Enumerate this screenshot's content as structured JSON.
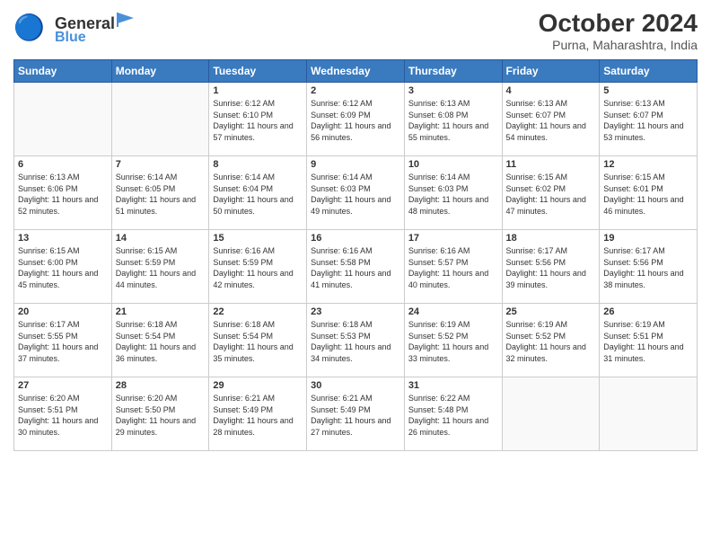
{
  "header": {
    "logo_general": "General",
    "logo_blue": "Blue",
    "title": "October 2024",
    "subtitle": "Purna, Maharashtra, India"
  },
  "calendar": {
    "headers": [
      "Sunday",
      "Monday",
      "Tuesday",
      "Wednesday",
      "Thursday",
      "Friday",
      "Saturday"
    ],
    "weeks": [
      [
        {
          "day": "",
          "info": ""
        },
        {
          "day": "",
          "info": ""
        },
        {
          "day": "1",
          "info": "Sunrise: 6:12 AM\nSunset: 6:10 PM\nDaylight: 11 hours and 57 minutes."
        },
        {
          "day": "2",
          "info": "Sunrise: 6:12 AM\nSunset: 6:09 PM\nDaylight: 11 hours and 56 minutes."
        },
        {
          "day": "3",
          "info": "Sunrise: 6:13 AM\nSunset: 6:08 PM\nDaylight: 11 hours and 55 minutes."
        },
        {
          "day": "4",
          "info": "Sunrise: 6:13 AM\nSunset: 6:07 PM\nDaylight: 11 hours and 54 minutes."
        },
        {
          "day": "5",
          "info": "Sunrise: 6:13 AM\nSunset: 6:07 PM\nDaylight: 11 hours and 53 minutes."
        }
      ],
      [
        {
          "day": "6",
          "info": "Sunrise: 6:13 AM\nSunset: 6:06 PM\nDaylight: 11 hours and 52 minutes."
        },
        {
          "day": "7",
          "info": "Sunrise: 6:14 AM\nSunset: 6:05 PM\nDaylight: 11 hours and 51 minutes."
        },
        {
          "day": "8",
          "info": "Sunrise: 6:14 AM\nSunset: 6:04 PM\nDaylight: 11 hours and 50 minutes."
        },
        {
          "day": "9",
          "info": "Sunrise: 6:14 AM\nSunset: 6:03 PM\nDaylight: 11 hours and 49 minutes."
        },
        {
          "day": "10",
          "info": "Sunrise: 6:14 AM\nSunset: 6:03 PM\nDaylight: 11 hours and 48 minutes."
        },
        {
          "day": "11",
          "info": "Sunrise: 6:15 AM\nSunset: 6:02 PM\nDaylight: 11 hours and 47 minutes."
        },
        {
          "day": "12",
          "info": "Sunrise: 6:15 AM\nSunset: 6:01 PM\nDaylight: 11 hours and 46 minutes."
        }
      ],
      [
        {
          "day": "13",
          "info": "Sunrise: 6:15 AM\nSunset: 6:00 PM\nDaylight: 11 hours and 45 minutes."
        },
        {
          "day": "14",
          "info": "Sunrise: 6:15 AM\nSunset: 5:59 PM\nDaylight: 11 hours and 44 minutes."
        },
        {
          "day": "15",
          "info": "Sunrise: 6:16 AM\nSunset: 5:59 PM\nDaylight: 11 hours and 42 minutes."
        },
        {
          "day": "16",
          "info": "Sunrise: 6:16 AM\nSunset: 5:58 PM\nDaylight: 11 hours and 41 minutes."
        },
        {
          "day": "17",
          "info": "Sunrise: 6:16 AM\nSunset: 5:57 PM\nDaylight: 11 hours and 40 minutes."
        },
        {
          "day": "18",
          "info": "Sunrise: 6:17 AM\nSunset: 5:56 PM\nDaylight: 11 hours and 39 minutes."
        },
        {
          "day": "19",
          "info": "Sunrise: 6:17 AM\nSunset: 5:56 PM\nDaylight: 11 hours and 38 minutes."
        }
      ],
      [
        {
          "day": "20",
          "info": "Sunrise: 6:17 AM\nSunset: 5:55 PM\nDaylight: 11 hours and 37 minutes."
        },
        {
          "day": "21",
          "info": "Sunrise: 6:18 AM\nSunset: 5:54 PM\nDaylight: 11 hours and 36 minutes."
        },
        {
          "day": "22",
          "info": "Sunrise: 6:18 AM\nSunset: 5:54 PM\nDaylight: 11 hours and 35 minutes."
        },
        {
          "day": "23",
          "info": "Sunrise: 6:18 AM\nSunset: 5:53 PM\nDaylight: 11 hours and 34 minutes."
        },
        {
          "day": "24",
          "info": "Sunrise: 6:19 AM\nSunset: 5:52 PM\nDaylight: 11 hours and 33 minutes."
        },
        {
          "day": "25",
          "info": "Sunrise: 6:19 AM\nSunset: 5:52 PM\nDaylight: 11 hours and 32 minutes."
        },
        {
          "day": "26",
          "info": "Sunrise: 6:19 AM\nSunset: 5:51 PM\nDaylight: 11 hours and 31 minutes."
        }
      ],
      [
        {
          "day": "27",
          "info": "Sunrise: 6:20 AM\nSunset: 5:51 PM\nDaylight: 11 hours and 30 minutes."
        },
        {
          "day": "28",
          "info": "Sunrise: 6:20 AM\nSunset: 5:50 PM\nDaylight: 11 hours and 29 minutes."
        },
        {
          "day": "29",
          "info": "Sunrise: 6:21 AM\nSunset: 5:49 PM\nDaylight: 11 hours and 28 minutes."
        },
        {
          "day": "30",
          "info": "Sunrise: 6:21 AM\nSunset: 5:49 PM\nDaylight: 11 hours and 27 minutes."
        },
        {
          "day": "31",
          "info": "Sunrise: 6:22 AM\nSunset: 5:48 PM\nDaylight: 11 hours and 26 minutes."
        },
        {
          "day": "",
          "info": ""
        },
        {
          "day": "",
          "info": ""
        }
      ]
    ]
  }
}
